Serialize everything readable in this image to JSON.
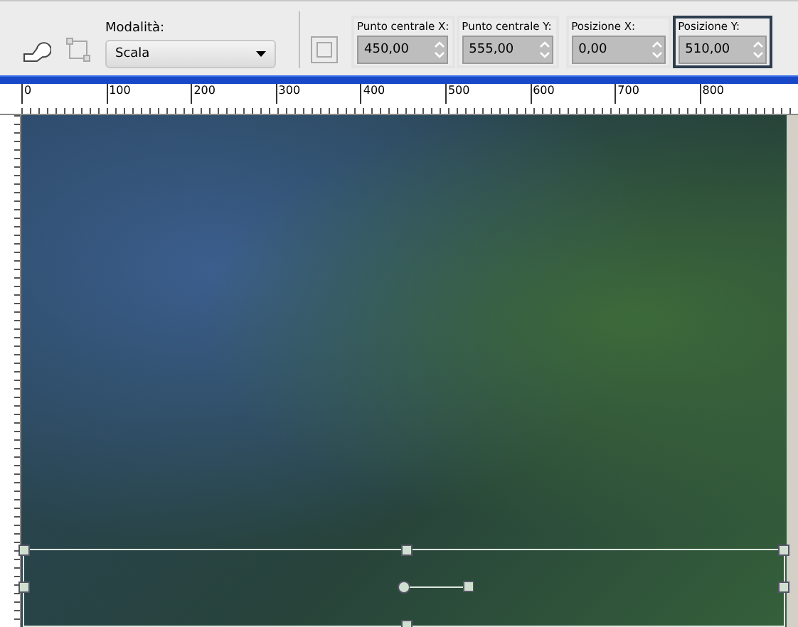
{
  "toolbar": {
    "mode": {
      "label": "Modalità:",
      "value": "Scala"
    },
    "fields": [
      {
        "label": "Punto centrale X:",
        "value": "450,00",
        "selected": false
      },
      {
        "label": "Punto centrale Y:",
        "value": "555,00",
        "selected": false
      },
      {
        "label": "Posizione X:",
        "value": "0,00",
        "selected": false
      },
      {
        "label": "Posizione Y:",
        "value": "510,00",
        "selected": true
      }
    ]
  },
  "ruler": {
    "labels": [
      "0",
      "100",
      "200",
      "300",
      "400",
      "500",
      "600",
      "700",
      "800"
    ]
  }
}
